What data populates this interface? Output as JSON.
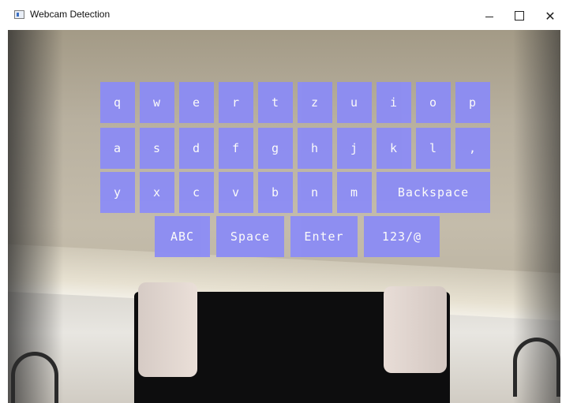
{
  "window": {
    "title": "Webcam Detection",
    "controls": {
      "minimize": "–",
      "maximize": "☐",
      "close": "✕"
    }
  },
  "keyboard": {
    "accent_color": "#8c8cf5",
    "row1": [
      "q",
      "w",
      "e",
      "r",
      "t",
      "z",
      "u",
      "i",
      "o",
      "p"
    ],
    "row2": [
      "a",
      "s",
      "d",
      "f",
      "g",
      "h",
      "j",
      "k",
      "l",
      ","
    ],
    "row3": [
      "y",
      "x",
      "c",
      "v",
      "b",
      "n",
      "m"
    ],
    "backspace": "Backspace",
    "bottom": [
      "ABC",
      "Space",
      "Enter",
      "123/@"
    ]
  }
}
